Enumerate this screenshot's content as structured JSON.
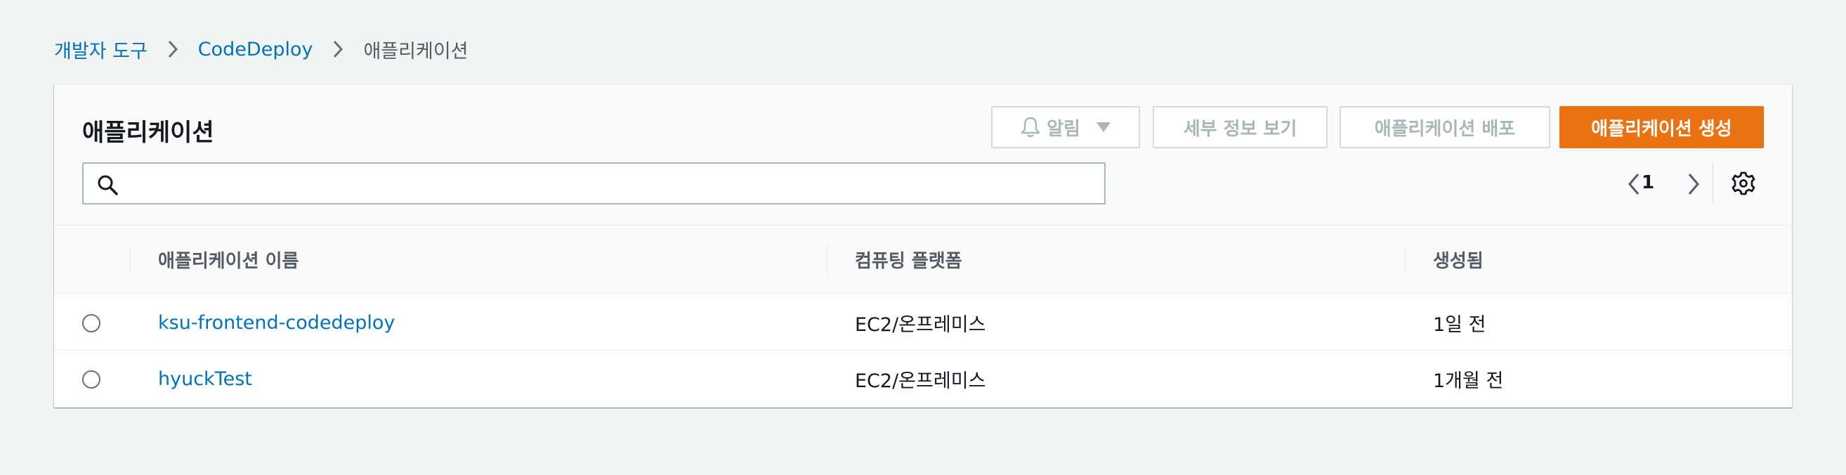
{
  "breadcrumb": {
    "items": [
      "개발자 도구",
      "CodeDeploy"
    ],
    "current": "애플리케이션"
  },
  "panel": {
    "title": "애플리케이션",
    "buttons": {
      "notify": "알림",
      "details": "세부 정보 보기",
      "deploy": "애플리케이션 배포",
      "create": "애플리케이션 생성"
    },
    "search": {
      "value": "",
      "placeholder": ""
    },
    "pagination": {
      "current_page": "1"
    }
  },
  "table": {
    "columns": [
      "애플리케이션 이름",
      "컴퓨팅 플랫폼",
      "생성됨"
    ],
    "rows": [
      {
        "name": "ksu-frontend-codedeploy",
        "platform": "EC2/온프레미스",
        "created": "1일 전"
      },
      {
        "name": "hyuckTest",
        "platform": "EC2/온프레미스",
        "created": "1개월 전"
      }
    ]
  },
  "colors": {
    "accent": "#ec7211",
    "link": "#0073bb",
    "background": "#f2f3f3",
    "disabled_text": "#aab7b8"
  },
  "icons": [
    "chevron-right-icon",
    "bell-icon",
    "caret-down-icon",
    "search-icon",
    "chevron-left-icon",
    "gear-icon"
  ]
}
